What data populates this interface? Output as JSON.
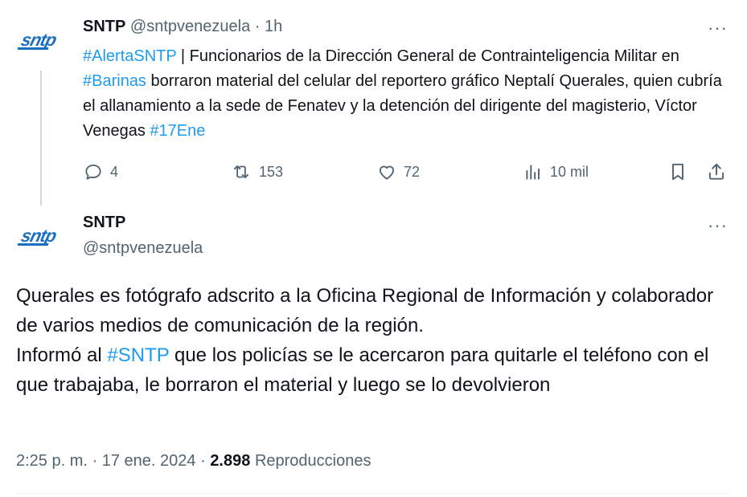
{
  "parent_tweet": {
    "author_name": "SNTP",
    "handle": "@sntpvenezuela",
    "separator": "·",
    "time": "1h",
    "text_segments": [
      {
        "text": "#AlertaSNTP",
        "type": "hashtag"
      },
      {
        "text": " | Funcionarios de la Dirección General de Contrainteligencia Militar en ",
        "type": "text"
      },
      {
        "text": "#Barinas",
        "type": "hashtag"
      },
      {
        "text": " borraron material del celular del reportero gráfico Neptalí Querales, quien cubría el allanamiento a la sede de Fenatev y la detención del dirigente del magisterio, Víctor Venegas ",
        "type": "text"
      },
      {
        "text": "#17Ene",
        "type": "hashtag"
      }
    ],
    "replies": "4",
    "retweets": "153",
    "likes": "72",
    "views": "10 mil",
    "more_label": "···"
  },
  "main_tweet": {
    "author_name": "SNTP",
    "handle": "@sntpvenezuela",
    "more_label": "···",
    "text_segments": [
      {
        "text": "Querales es fotógrafo adscrito a la Oficina Regional de Información y colaborador de varios medios de comunicación de la región.",
        "type": "text"
      },
      {
        "text": "\n",
        "type": "break"
      },
      {
        "text": "Informó al ",
        "type": "text"
      },
      {
        "text": "#SNTP",
        "type": "hashtag"
      },
      {
        "text": " que los policías se le acercaron para quitarle el teléfono con el que trabajaba,  le borraron el material y luego se lo devolvieron",
        "type": "text"
      }
    ],
    "time": "2:25 p. m.",
    "date": "17 ene. 2024",
    "dot": "·",
    "views_count": "2.898",
    "views_label": "Reproducciones"
  },
  "colors": {
    "accent": "#1d9bf0",
    "logo": "#1b6fc0",
    "muted": "#536471",
    "text": "#0f1419"
  },
  "icons": [
    "sntp-logo",
    "more-icon",
    "reply-icon",
    "retweet-icon",
    "like-icon",
    "views-icon",
    "bookmark-icon",
    "share-icon"
  ]
}
